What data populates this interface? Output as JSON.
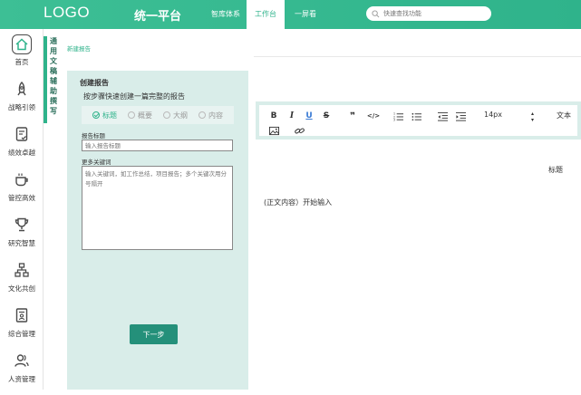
{
  "header": {
    "logo": "LOGO",
    "platform": "统一平台",
    "nav": [
      {
        "label": "智库体系",
        "active": false
      },
      {
        "label": "工作台",
        "active": true
      },
      {
        "label": "一屏看",
        "active": false
      }
    ],
    "search_placeholder": "快速查找功能"
  },
  "sidebar": {
    "items": [
      {
        "label": "首页",
        "icon": "home-icon",
        "active": true
      },
      {
        "label": "战略引领",
        "icon": "rocket-icon"
      },
      {
        "label": "绩效卓越",
        "icon": "document-check-icon"
      },
      {
        "label": "管控高效",
        "icon": "cup-icon"
      },
      {
        "label": "研究智慧",
        "icon": "trophy-icon"
      },
      {
        "label": "文化共创",
        "icon": "hierarchy-icon"
      },
      {
        "label": "综合管理",
        "icon": "file-user-icon"
      },
      {
        "label": "人资管理",
        "icon": "users-icon"
      }
    ]
  },
  "subnav": {
    "label": "通用文稿辅助撰写"
  },
  "breadcrumb": "新建报告",
  "form": {
    "title": "创建报告",
    "description": "按步骤快速创建一篇完整的报告",
    "steps": [
      {
        "label": "标题",
        "active": true
      },
      {
        "label": "概要",
        "active": false
      },
      {
        "label": "大纲",
        "active": false
      },
      {
        "label": "内容",
        "active": false
      }
    ],
    "report_title_label": "报告标题",
    "report_title_placeholder": "输入报告标题",
    "keywords_label": "更多关键词",
    "keywords_placeholder": "输入关键词，如工作总结，项目报告；多个关键次用分号隔开",
    "next_button": "下一步"
  },
  "editor": {
    "toolbar": {
      "bold": "B",
      "italic": "I",
      "underline": "U",
      "strike": "S",
      "quote": "❞",
      "code": "</>",
      "font_size": "14px",
      "text": "文本"
    },
    "heading": "标题",
    "body": "(正文内容）开始输入"
  },
  "colors": {
    "primary": "#2fb38b",
    "button": "#24907a",
    "panel": "#d9ede9"
  }
}
